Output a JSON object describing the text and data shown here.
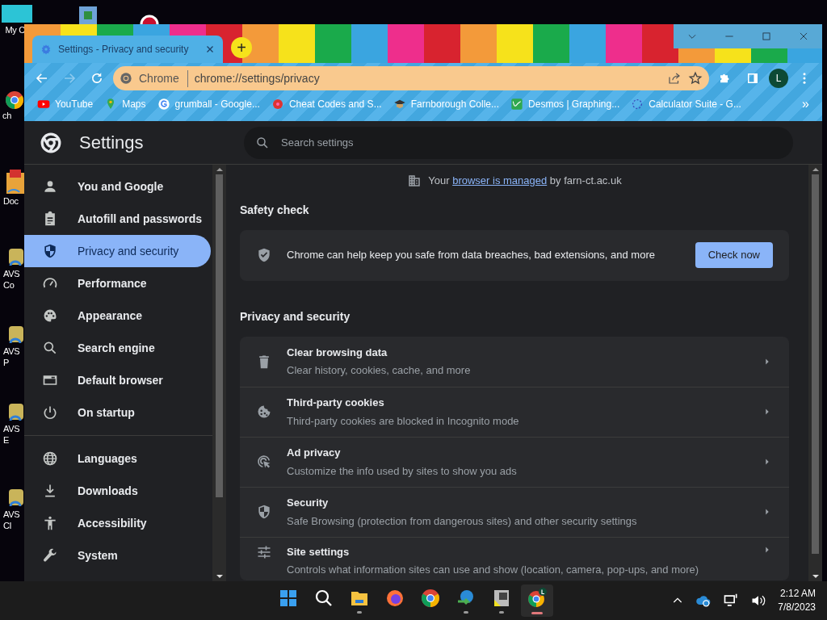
{
  "desktop": {
    "icons": [
      {
        "kind": "monitor",
        "label": "My C"
      },
      {
        "kind": "app"
      },
      {
        "kind": "record"
      },
      {
        "kind": "chrome",
        "label": "ch"
      },
      {
        "kind": "folder",
        "label": "Doc"
      },
      {
        "kind": "avs",
        "label": "AVS Co"
      },
      {
        "kind": "avs",
        "label": "AVS P"
      },
      {
        "kind": "avs",
        "label": "AVS E"
      },
      {
        "kind": "avs",
        "label": "AVS Cl"
      }
    ]
  },
  "browser": {
    "tab": {
      "title": "Settings - Privacy and security",
      "selected": true
    },
    "new_tab": "+",
    "omnibox": {
      "chip": "Chrome",
      "url": "chrome://settings/privacy"
    },
    "profile": "L",
    "bookmarks": [
      {
        "label": "YouTube",
        "kind": "youtube"
      },
      {
        "label": "Maps",
        "kind": "maps"
      },
      {
        "label": "grumball - Google...",
        "kind": "google"
      },
      {
        "label": "Cheat Codes and S...",
        "kind": "cheat"
      },
      {
        "label": "Farnborough Colle...",
        "kind": "college"
      },
      {
        "label": "Desmos | Graphing...",
        "kind": "desmos"
      },
      {
        "label": "Calculator Suite - G...",
        "kind": "calc"
      }
    ],
    "bookmarks_overflow": "»"
  },
  "settings": {
    "title": "Settings",
    "search": {
      "placeholder": "Search settings"
    },
    "nav_groups": [
      [
        {
          "label": "You and Google",
          "kind": "person",
          "selected": false
        },
        {
          "label": "Autofill and passwords",
          "kind": "clipboard",
          "selected": false
        },
        {
          "label": "Privacy and security",
          "kind": "shield",
          "selected": true
        },
        {
          "label": "Performance",
          "kind": "gauge",
          "selected": false
        },
        {
          "label": "Appearance",
          "kind": "palette",
          "selected": false
        },
        {
          "label": "Search engine",
          "kind": "search",
          "selected": false
        },
        {
          "label": "Default browser",
          "kind": "browser",
          "selected": false
        },
        {
          "label": "On startup",
          "kind": "power",
          "selected": false
        }
      ],
      [
        {
          "label": "Languages",
          "kind": "globe",
          "selected": false
        },
        {
          "label": "Downloads",
          "kind": "download",
          "selected": false
        },
        {
          "label": "Accessibility",
          "kind": "accessibility",
          "selected": false
        },
        {
          "label": "System",
          "kind": "wrench",
          "selected": false
        }
      ]
    ],
    "managed": {
      "before": "Your",
      "link": "browser is managed",
      "after": "by farn-ct.ac.uk"
    },
    "safety_check": {
      "heading": "Safety check",
      "text": "Chrome can help keep you safe from data breaches, bad extensions, and more",
      "button": "Check now"
    },
    "privacy": {
      "heading": "Privacy and security",
      "rows": [
        {
          "kind": "trash",
          "title": "Clear browsing data",
          "subtitle": "Clear history, cookies, cache, and more"
        },
        {
          "kind": "cookie",
          "title": "Third-party cookies",
          "subtitle": "Third-party cookies are blocked in Incognito mode"
        },
        {
          "kind": "target",
          "title": "Ad privacy",
          "subtitle": "Customize the info used by sites to show you ads"
        },
        {
          "kind": "shield",
          "title": "Security",
          "subtitle": "Safe Browsing (protection from dangerous sites) and other security settings"
        },
        {
          "kind": "sliders",
          "title": "Site settings",
          "subtitle": "Controls what information sites can use and show (location, camera, pop-ups, and more)"
        }
      ]
    }
  },
  "taskbar": {
    "apps": [
      {
        "kind": "start",
        "running": false,
        "active": false
      },
      {
        "kind": "search",
        "running": false,
        "active": false
      },
      {
        "kind": "folder",
        "running": true,
        "active": false
      },
      {
        "kind": "firefox",
        "running": false,
        "active": false
      },
      {
        "kind": "chrome",
        "running": false,
        "active": false
      },
      {
        "kind": "idm",
        "running": true,
        "active": false
      },
      {
        "kind": "app",
        "running": true,
        "active": false
      },
      {
        "kind": "chrome-profile",
        "running": true,
        "active": true
      }
    ],
    "time": "2:12 AM",
    "date": "7/8/2023"
  }
}
